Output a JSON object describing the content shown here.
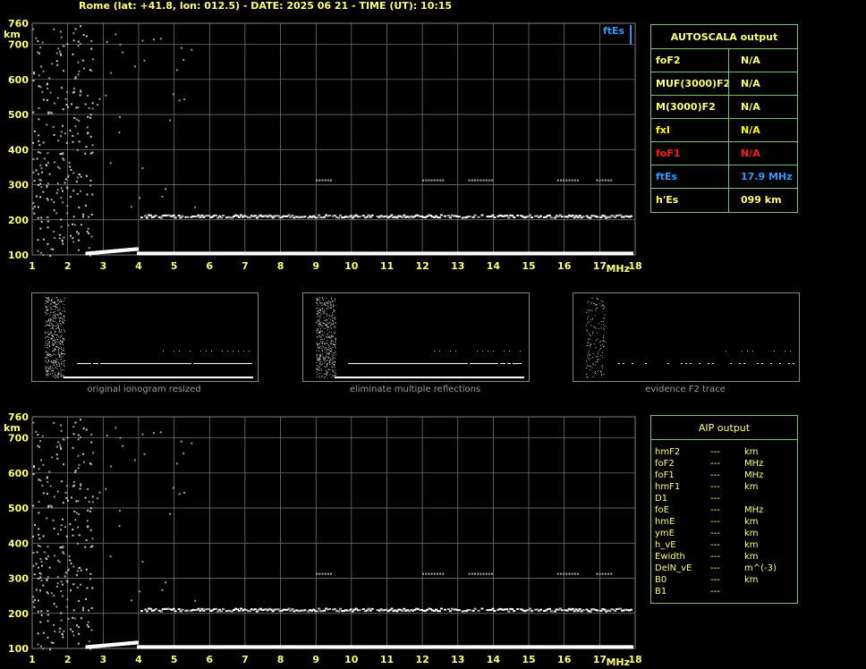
{
  "header": "Rome (lat: +41.8, lon: 012.5) - DATE: 2025 06 21 - TIME (UT): 10:15",
  "colors": {
    "background": "#000000",
    "grid": "#808080",
    "axis_text": "#ffff80",
    "panel_border": "#7fbf7f",
    "ftEs": "#3399ff",
    "foF1": "#ff2020",
    "trace": "#ffffff"
  },
  "chart_data": [
    {
      "type": "scatter",
      "name": "ionogram-top",
      "xlabel": "MHz",
      "ylabel": "km",
      "x_ticks": [
        1,
        2,
        3,
        4,
        5,
        6,
        7,
        8,
        9,
        10,
        11,
        12,
        13,
        14,
        15,
        16,
        17,
        18
      ],
      "y_ticks": [
        100,
        200,
        300,
        400,
        500,
        600,
        700,
        760
      ],
      "xlim": [
        1,
        18
      ],
      "ylim": [
        100,
        760
      ],
      "grid": true,
      "annotation": "ftEs",
      "traces": [
        {
          "label": "E trace",
          "x": [
            2.5,
            18
          ],
          "y": 105
        },
        {
          "label": "E rise",
          "x": [
            3.0,
            3.8
          ],
          "y": [
            108,
            120
          ]
        },
        {
          "label": "Es trace",
          "x": [
            4.0,
            17.9
          ],
          "y": 210
        },
        {
          "label": "weak layer",
          "x": [
            9.0,
            17.0
          ],
          "y": 315
        }
      ]
    },
    {
      "type": "scatter",
      "name": "ionogram-bottom",
      "xlabel": "MHz",
      "ylabel": "km",
      "x_ticks": [
        1,
        2,
        3,
        4,
        5,
        6,
        7,
        8,
        9,
        10,
        11,
        12,
        13,
        14,
        15,
        16,
        17,
        18
      ],
      "y_ticks": [
        100,
        200,
        300,
        400,
        500,
        600,
        700,
        760
      ],
      "xlim": [
        1,
        18
      ],
      "ylim": [
        100,
        760
      ],
      "grid": true
    }
  ],
  "autoscala": {
    "title": "AUTOSCALA output",
    "rows": [
      {
        "key": "foF2",
        "value": "N/A",
        "color": "#ffff80"
      },
      {
        "key": "MUF(3000)F2",
        "value": "N/A",
        "color": "#ffff80"
      },
      {
        "key": "M(3000)F2",
        "value": "N/A",
        "color": "#ffff80"
      },
      {
        "key": "fxI",
        "value": "N/A",
        "color": "#ffff00"
      },
      {
        "key": "foF1",
        "value": "N/A",
        "color": "#ff2020"
      },
      {
        "key": "ftEs",
        "value": "17.9 MHz",
        "color": "#3399ff"
      },
      {
        "key": "h'Es",
        "value": "099      km",
        "color": "#ffff80"
      }
    ]
  },
  "thumbnails": [
    {
      "caption": "original ionogram resized"
    },
    {
      "caption": "eliminate multiple reflections"
    },
    {
      "caption": "evidence F2 trace"
    }
  ],
  "aip": {
    "title": "AIP output",
    "rows": [
      {
        "key": "hmF2",
        "value": "---",
        "unit": "km"
      },
      {
        "key": "foF2",
        "value": "---",
        "unit": "MHz"
      },
      {
        "key": "foF1",
        "value": "---",
        "unit": "MHz"
      },
      {
        "key": "hmF1",
        "value": "---",
        "unit": "km"
      },
      {
        "key": "D1",
        "value": "---",
        "unit": ""
      },
      {
        "key": "foE",
        "value": "---",
        "unit": "MHz"
      },
      {
        "key": "hmE",
        "value": "---",
        "unit": "km"
      },
      {
        "key": "ymE",
        "value": "---",
        "unit": "km"
      },
      {
        "key": "h_vE",
        "value": "---",
        "unit": "km"
      },
      {
        "key": "Ewidth",
        "value": "---",
        "unit": "km"
      },
      {
        "key": "DelN_vE",
        "value": "---",
        "unit": "m^(-3)"
      },
      {
        "key": "B0",
        "value": "---",
        "unit": "km"
      },
      {
        "key": "B1",
        "value": "---",
        "unit": ""
      }
    ]
  }
}
